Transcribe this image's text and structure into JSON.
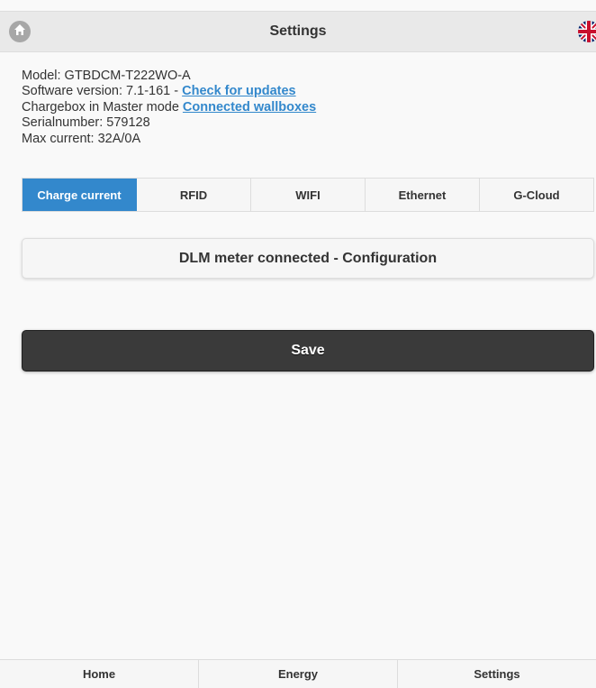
{
  "header": {
    "title": "Settings",
    "home_icon": "home-icon",
    "flag_icon": "uk-flag-icon"
  },
  "info": {
    "model": "Model: GTBDCM-T222WO-A",
    "software_prefix": "Software version: 7.1-161 - ",
    "software_link": "Check for updates",
    "mode_prefix": "Chargebox in Master mode ",
    "mode_link": "Connected wallboxes",
    "serial": "Serialnumber: 579128",
    "max_current": "Max current: 32A/0A"
  },
  "tabs": [
    {
      "label": "Charge current",
      "active": true
    },
    {
      "label": "RFID",
      "active": false
    },
    {
      "label": "WIFI",
      "active": false
    },
    {
      "label": "Ethernet",
      "active": false
    },
    {
      "label": "G-Cloud",
      "active": false
    }
  ],
  "dlm_button": "DLM meter connected - Configuration",
  "save_button": "Save",
  "footer": [
    {
      "label": "Home"
    },
    {
      "label": "Energy"
    },
    {
      "label": "Settings"
    }
  ],
  "colors": {
    "accent": "#3388cc",
    "save_bg": "#3a3a3a",
    "header_bg": "#e9e9e9"
  }
}
